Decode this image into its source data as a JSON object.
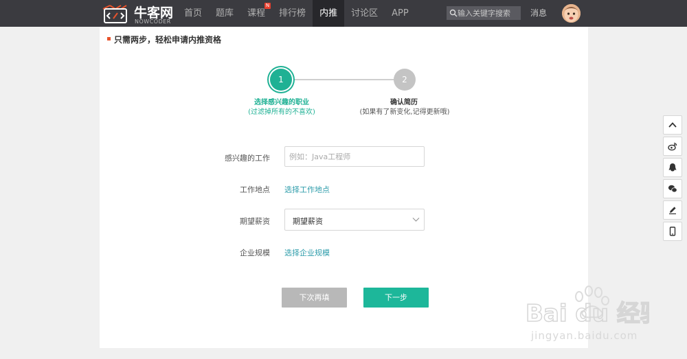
{
  "header": {
    "logo_text": "牛客网",
    "logo_sub": "NOWCODER",
    "nav": [
      {
        "label": "首页"
      },
      {
        "label": "题库"
      },
      {
        "label": "课程",
        "badge": "N"
      },
      {
        "label": "排行榜"
      },
      {
        "label": "内推",
        "active": true
      },
      {
        "label": "讨论区"
      },
      {
        "label": "APP"
      }
    ],
    "search_placeholder": "输入关键字搜索",
    "messages_label": "消息"
  },
  "page": {
    "section_title": "只需两步，轻松申请内推资格",
    "steps": [
      {
        "number": "1",
        "title": "选择感兴趣的职业",
        "subtitle": "(过滤掉所有的不喜欢)",
        "state": "current"
      },
      {
        "number": "2",
        "title": "确认简历",
        "subtitle": "(如果有了新变化,记得更新哦)",
        "state": "pending"
      }
    ],
    "form": {
      "job_label": "感兴趣的工作",
      "job_placeholder": "例如：Java工程师",
      "location_label": "工作地点",
      "location_link": "选择工作地点",
      "salary_label": "期望薪资",
      "salary_value": "期望薪资",
      "size_label": "企业规模",
      "size_link": "选择企业规模"
    },
    "buttons": {
      "later": "下次再填",
      "next": "下一步"
    }
  },
  "sidebar_tools": [
    "chevron-up-icon",
    "weibo-icon",
    "qq-icon",
    "wechat-icon",
    "pencil-icon",
    "phone-icon"
  ],
  "watermark": {
    "brand": "Bai du 经验",
    "url": "jingyan.baidu.com"
  },
  "colors": {
    "accent": "#1fb194",
    "link": "#2f9dab",
    "topbar": "#3b3b40",
    "inactive_step": "#c4c4c4",
    "disabled_button": "#b8b8b8"
  }
}
